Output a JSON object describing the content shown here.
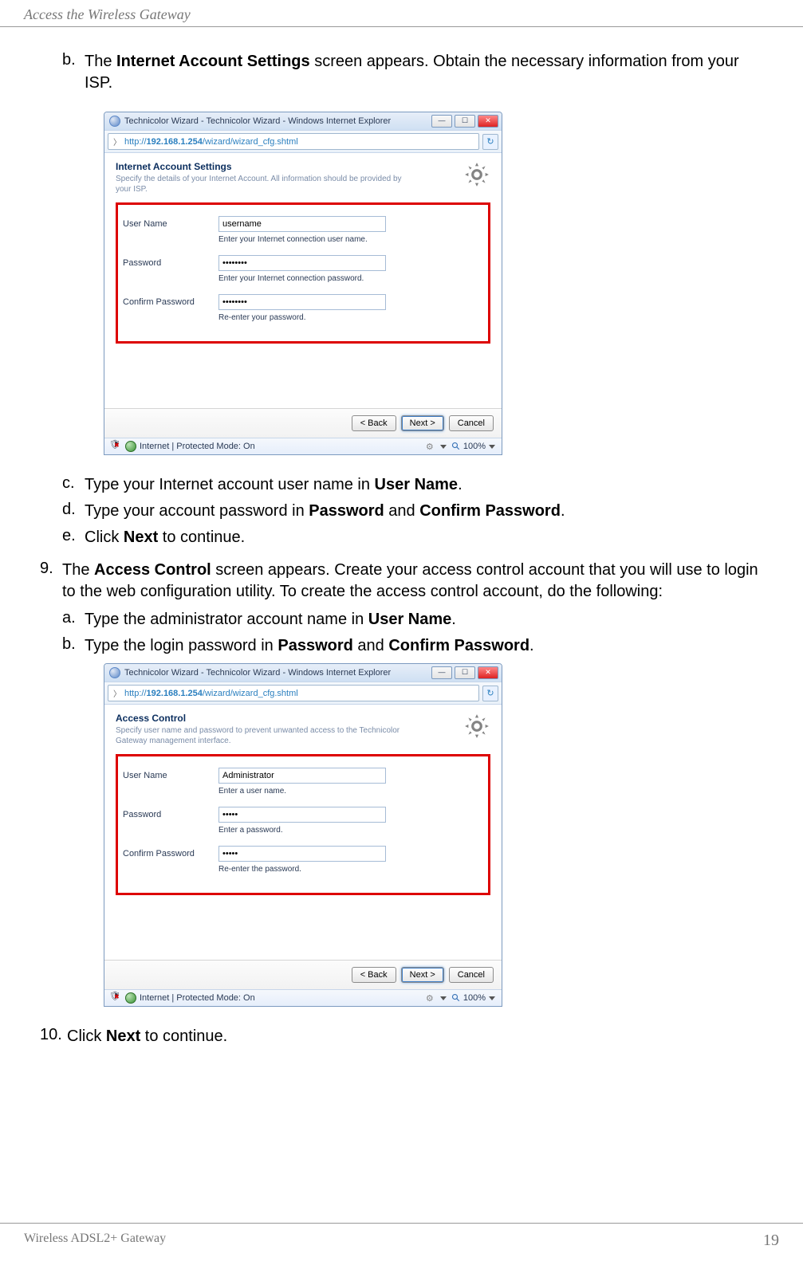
{
  "header": {
    "title": "Access the Wireless Gateway"
  },
  "body": {
    "step_b_bullet": "b.",
    "step_b_pre": "The ",
    "step_b_bold": "Internet Account Settings",
    "step_b_post": " screen appears. Obtain the necessary information from your ISP.",
    "step_c_bullet": "c.",
    "step_c_pre": "Type your Internet account user name in ",
    "step_c_bold": "User Name",
    "step_c_post": ".",
    "step_d_bullet": "d.",
    "step_d_pre": "Type your account password in ",
    "step_d_bold1": "Password",
    "step_d_mid": " and ",
    "step_d_bold2": "Confirm Password",
    "step_d_post": ".",
    "step_e_bullet": "e.",
    "step_e_pre": "Click ",
    "step_e_bold": "Next",
    "step_e_post": " to continue.",
    "step9_bullet": "9.",
    "step9_pre": "The ",
    "step9_bold": "Access Control",
    "step9_post": " screen appears. Create your access control account that you will use to login to the web configuration utility. To create the access control account, do the following:",
    "step9a_bullet": "a.",
    "step9a_pre": "Type the administrator account name in ",
    "step9a_bold": "User Name",
    "step9a_post": ".",
    "step9b_bullet": "b.",
    "step9b_pre": "Type the login password in ",
    "step9b_bold1": "Password",
    "step9b_mid": " and ",
    "step9b_bold2": "Confirm Password",
    "step9b_post": ".",
    "step10_bullet": "10.",
    "step10_pre": "Click ",
    "step10_bold": "Next",
    "step10_post": " to continue."
  },
  "window1": {
    "title": "Technicolor Wizard - Technicolor Wizard - Windows Internet Explorer",
    "url_pre": "http://",
    "url_bold": "192.168.1.254",
    "url_post": "/wizard/wizard_cfg.shtml",
    "wiz_title": "Internet Account Settings",
    "wiz_subtitle": "Specify the details of your Internet Account. All information should be provided by your ISP.",
    "user_label": "User Name",
    "user_value": "username",
    "user_hint": "Enter your Internet connection user name.",
    "pass_label": "Password",
    "pass_value": "••••••••",
    "pass_hint": "Enter your Internet connection password.",
    "confirm_label": "Confirm Password",
    "confirm_value": "••••••••",
    "confirm_hint": "Re-enter your password.",
    "back": "< Back",
    "next": "Next >",
    "cancel": "Cancel",
    "status": "Internet | Protected Mode: On",
    "zoom": "100%"
  },
  "window2": {
    "title": "Technicolor Wizard - Technicolor Wizard - Windows Internet Explorer",
    "url_pre": "http://",
    "url_bold": "192.168.1.254",
    "url_post": "/wizard/wizard_cfg.shtml",
    "wiz_title": "Access Control",
    "wiz_subtitle": "Specify user name and password to prevent unwanted access to the Technicolor Gateway management interface.",
    "user_label": "User Name",
    "user_value": "Administrator",
    "user_hint": "Enter a user name.",
    "pass_label": "Password",
    "pass_value": "•••••",
    "pass_hint": "Enter a password.",
    "confirm_label": "Confirm Password",
    "confirm_value": "•••••",
    "confirm_hint": "Re-enter the password.",
    "back": "< Back",
    "next": "Next >",
    "cancel": "Cancel",
    "status": "Internet | Protected Mode: On",
    "zoom": "100%"
  },
  "footer": {
    "left": "Wireless ADSL2+ Gateway",
    "page": "19"
  }
}
